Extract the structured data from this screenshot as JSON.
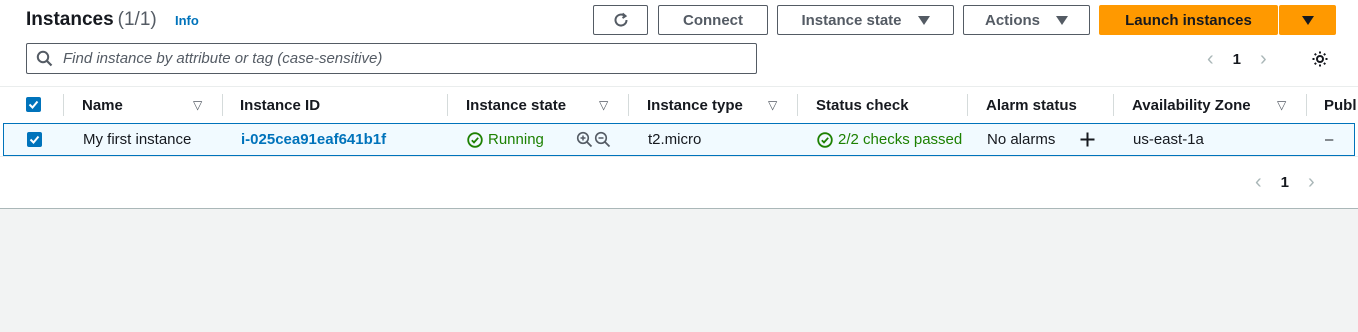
{
  "header": {
    "title": "Instances",
    "count": "(1/1)",
    "info": "Info",
    "buttons": {
      "refresh_icon": "refresh-icon",
      "connect": "Connect",
      "instance_state": "Instance state",
      "actions": "Actions",
      "launch": "Launch instances"
    }
  },
  "search": {
    "placeholder": "Find instance by attribute or tag (case-sensitive)",
    "value": ""
  },
  "pagination": {
    "current_page": "1"
  },
  "table": {
    "columns": [
      "Name",
      "Instance ID",
      "Instance state",
      "Instance type",
      "Status check",
      "Alarm status",
      "Availability Zone",
      "Publ"
    ],
    "rows": [
      {
        "name": "My first instance",
        "instance_id": "i-025cea91eaf641b1f",
        "state": "Running",
        "type": "t2.micro",
        "status_check": "2/2 checks passed",
        "alarm_status": "No alarms",
        "zone": "us-east-1a",
        "public": "–"
      }
    ]
  },
  "bottom_pagination": {
    "current_page": "1"
  },
  "colors": {
    "accent": "#0073bb",
    "primary": "#ff9900",
    "success": "#1d8102"
  }
}
